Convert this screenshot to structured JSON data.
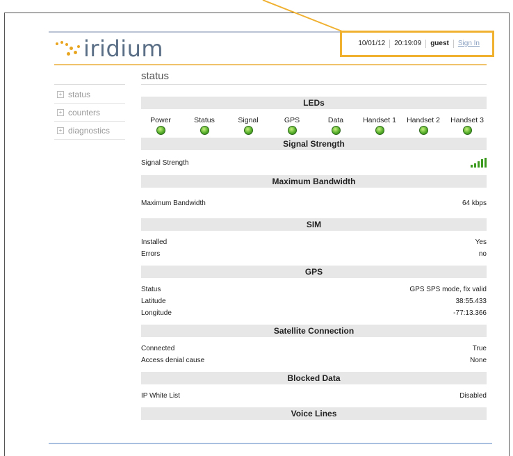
{
  "brand": {
    "name": "iridium"
  },
  "user_bar": {
    "date": "10/01/12",
    "time": "20:19:09",
    "user": "guest",
    "sign_in": "Sign In"
  },
  "page_title": "status",
  "sidebar": {
    "items": [
      {
        "label": "status"
      },
      {
        "label": "counters"
      },
      {
        "label": "diagnostics"
      }
    ]
  },
  "sections": {
    "leds": {
      "title": "LEDs",
      "items": [
        {
          "label": "Power"
        },
        {
          "label": "Status"
        },
        {
          "label": "Signal"
        },
        {
          "label": "GPS"
        },
        {
          "label": "Data"
        },
        {
          "label": "Handset 1"
        },
        {
          "label": "Handset 2"
        },
        {
          "label": "Handset 3"
        }
      ]
    },
    "signal": {
      "title": "Signal Strength",
      "label": "Signal Strength",
      "bars": 5
    },
    "bandwidth": {
      "title": "Maximum Bandwidth",
      "label": "Maximum Bandwidth",
      "value": "64 kbps"
    },
    "sim": {
      "title": "SIM",
      "rows": [
        {
          "label": "Installed",
          "value": "Yes"
        },
        {
          "label": "Errors",
          "value": "no"
        }
      ]
    },
    "gps": {
      "title": "GPS",
      "rows": [
        {
          "label": "Status",
          "value": "GPS SPS mode, fix valid"
        },
        {
          "label": "Latitude",
          "value": "38:55.433"
        },
        {
          "label": "Longitude",
          "value": "-77:13.366"
        }
      ]
    },
    "satellite": {
      "title": "Satellite Connection",
      "rows": [
        {
          "label": "Connected",
          "value": "True"
        },
        {
          "label": "Access denial cause",
          "value": "None"
        }
      ]
    },
    "blocked": {
      "title": "Blocked Data",
      "rows": [
        {
          "label": "IP White List",
          "value": "Disabled"
        }
      ]
    },
    "voice": {
      "title": "Voice Lines"
    }
  },
  "colors": {
    "accent": "#f0b030",
    "led_green": "#58b02c",
    "logo_text": "#5a6f86",
    "section_bg": "#e7e7e7"
  }
}
